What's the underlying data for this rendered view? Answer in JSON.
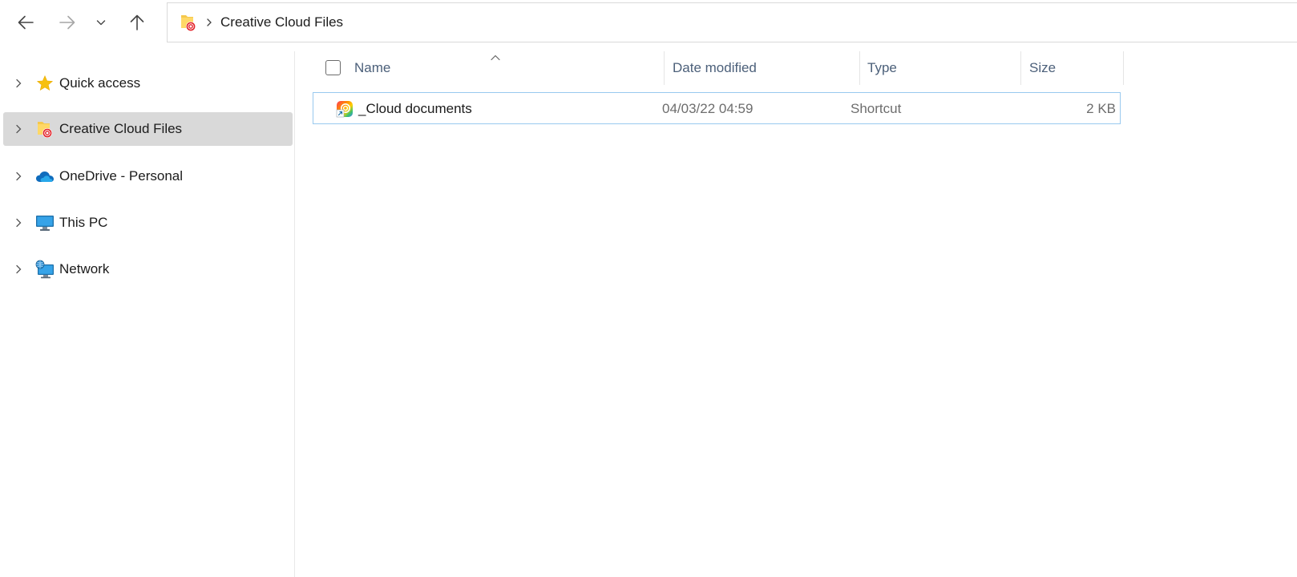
{
  "window": {
    "current_folder": "Creative Cloud Files"
  },
  "nav": {
    "back_icon": "arrow-left-icon",
    "forward_icon": "arrow-right-icon",
    "recent_icon": "chevron-down-icon",
    "up_icon": "arrow-up-icon"
  },
  "addressbar": {
    "icon": "creative-cloud-folder-icon",
    "separator_icon": "chevron-right-icon",
    "crumbs": [
      "Creative Cloud Files"
    ]
  },
  "sidebar": {
    "items": [
      {
        "label": "Quick access",
        "icon": "star-icon",
        "selected": false
      },
      {
        "label": "Creative Cloud Files",
        "icon": "creative-cloud-folder-icon",
        "selected": true
      },
      {
        "label": "OneDrive - Personal",
        "icon": "onedrive-cloud-icon",
        "selected": false
      },
      {
        "label": "This PC",
        "icon": "monitor-icon",
        "selected": false
      },
      {
        "label": "Network",
        "icon": "network-icon",
        "selected": false
      }
    ]
  },
  "details": {
    "columns": [
      "Name",
      "Date modified",
      "Type",
      "Size"
    ],
    "sorted_by": "Name",
    "rows": [
      {
        "name": "_Cloud documents",
        "date_modified": "04/03/22 04:59",
        "type": "Shortcut",
        "size": "2 KB",
        "icon": "creative-cloud-shortcut-icon"
      }
    ]
  },
  "colors": {
    "selection": "#d9d9d9",
    "row_focus_border": "#99c9ef",
    "header_text": "#4c607a",
    "secondary_text": "#6d6d6d",
    "star": "#f7c00f",
    "onedrive": "#0f6cbd",
    "cc_red": "#e3242b"
  }
}
